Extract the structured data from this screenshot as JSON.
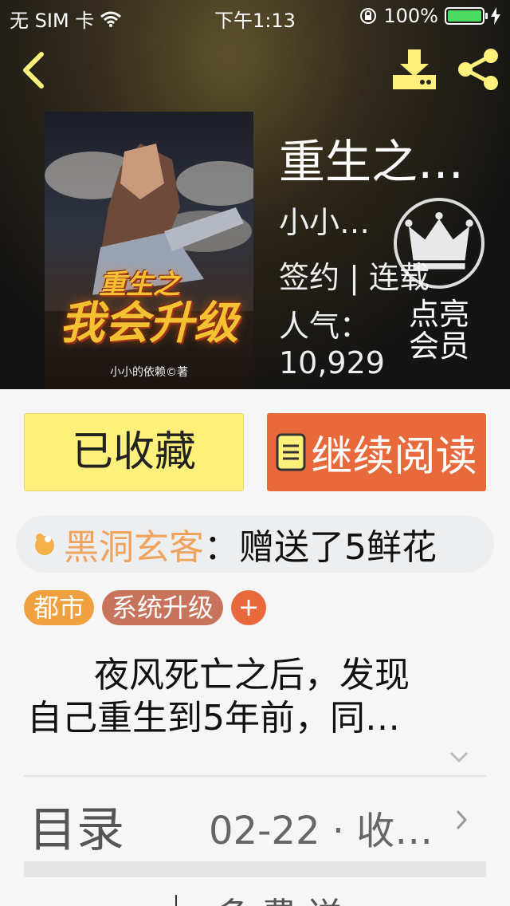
{
  "status_bar": {
    "carrier": "无 SIM 卡",
    "time": "下午1:13",
    "battery": "100%"
  },
  "header": {
    "back_icon": "chevron-left-icon",
    "download_icon": "download-icon",
    "share_icon": "share-icon",
    "accent_color": "#fdf17c"
  },
  "book": {
    "cover_title_small": "重生之",
    "cover_title_main": "我会升级",
    "cover_author": "小小的依赖©著",
    "title": "重生之…",
    "author": "小小…",
    "status": "签约 | 连载",
    "popularity_label": "人气：",
    "popularity_value": "10,929"
  },
  "vip": {
    "icon": "crown-icon",
    "label": "点亮会员"
  },
  "actions": {
    "favorite_label": "已收藏",
    "read_label": "继续阅读",
    "read_icon": "book-icon",
    "favorite_color": "#fdf17c",
    "read_color": "#e8693b"
  },
  "gift": {
    "icon": "flower-icon",
    "user": "黑洞玄客",
    "text": "：赠送了5鲜花"
  },
  "tags": {
    "items": [
      "都市",
      "系统升级"
    ],
    "add_label": "+"
  },
  "description": {
    "line1": "夜风死亡之后，发现",
    "line2": "自己重生到5年前，同…",
    "expand_icon": "chevron-down-icon"
  },
  "toc": {
    "label": "目录",
    "update": "02-22 · 收…",
    "chevron_icon": "chevron-right-icon"
  },
  "bottom_peek": {
    "text": "多 费 送"
  }
}
